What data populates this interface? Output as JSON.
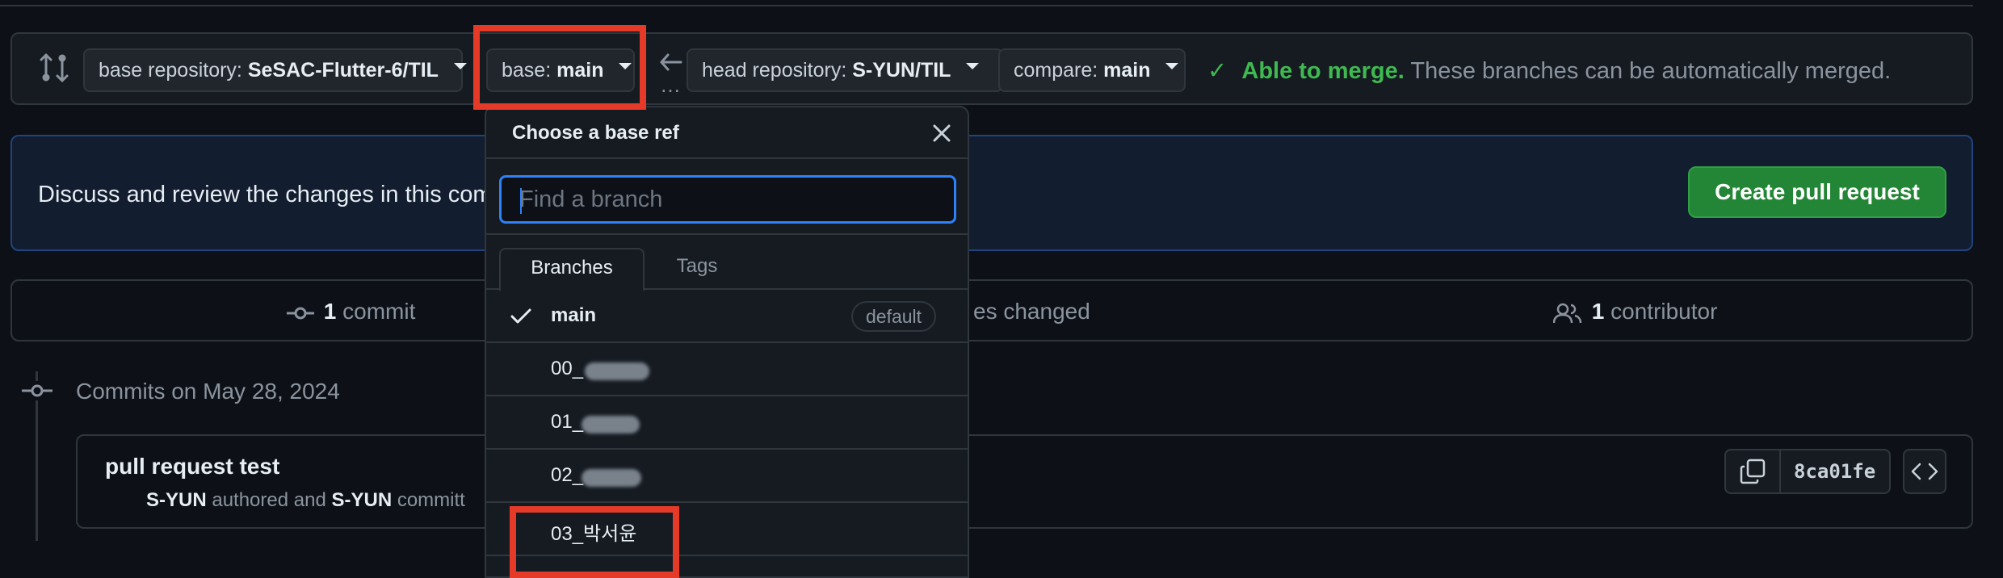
{
  "compare_bar": {
    "base_repository_prefix": "base repository:",
    "base_repository_value": "SeSAC-Flutter-6/TIL",
    "base_prefix": "base:",
    "base_value": "main",
    "head_repository_prefix": "head repository:",
    "head_repository_value": "S-YUN/TIL",
    "compare_prefix": "compare:",
    "compare_value": "main",
    "dots": "…",
    "merge_check": "✓",
    "merge_ok": "Able to merge.",
    "merge_desc": "These branches can be automatically merged."
  },
  "banner": {
    "text": "Discuss and review the changes in this com",
    "create_button": "Create pull request"
  },
  "stats": {
    "commits_count": "1",
    "commits_label": "commit",
    "files_label": "es changed",
    "contributors_count": "1",
    "contributors_label": "contributor"
  },
  "timeline": {
    "date_label": "Commits on May 28, 2024"
  },
  "commit": {
    "title": "pull request test",
    "author": "S-YUN",
    "authored_text": "authored and",
    "committer": "S-YUN",
    "committed_text": "committ",
    "sha": "8ca01fe"
  },
  "dropdown": {
    "title": "Choose a base ref",
    "search_placeholder": "Find a branch",
    "tabs": [
      "Branches",
      "Tags"
    ],
    "items": [
      {
        "name": "main",
        "badge": "default",
        "selected": true
      },
      {
        "name": "00_",
        "redacted": true
      },
      {
        "name": "01_",
        "redacted": true
      },
      {
        "name": "02_",
        "redacted": true
      },
      {
        "name": "03_박서윤",
        "redacted": false
      }
    ]
  },
  "colors": {
    "accent_blue": "#2f81f7",
    "success_green": "#3fb950",
    "primary_button": "#238636",
    "highlight_red": "#e53a27"
  }
}
